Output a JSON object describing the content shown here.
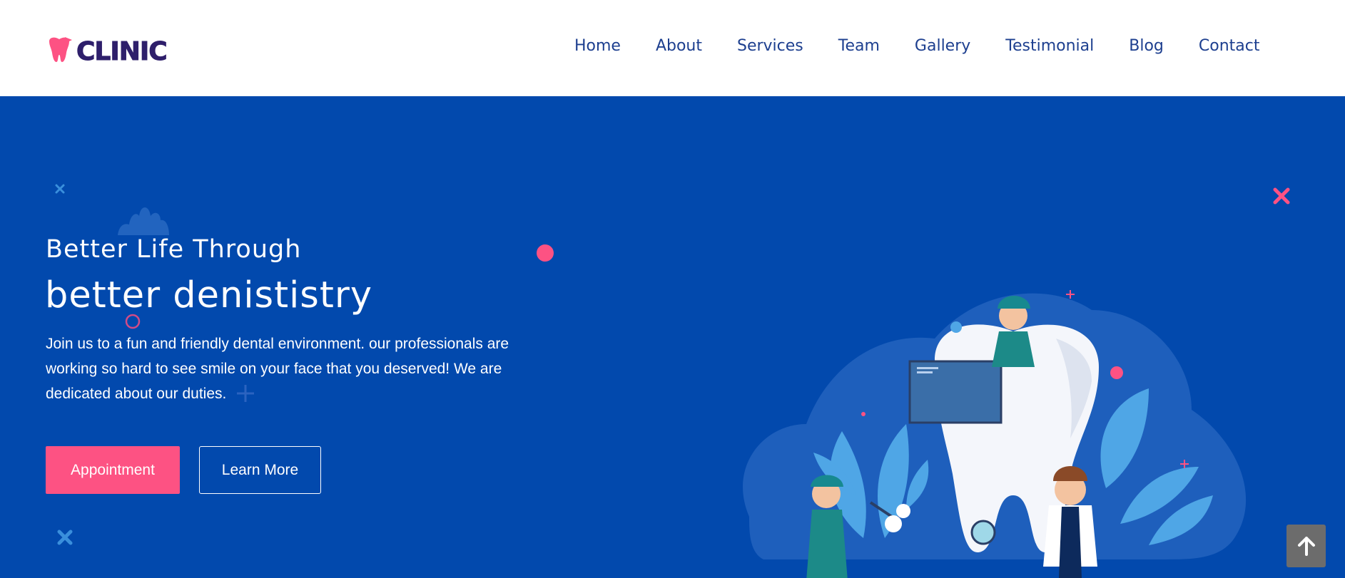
{
  "header": {
    "logo_text": "CLINIC",
    "nav": [
      "Home",
      "About",
      "Services",
      "Team",
      "Gallery",
      "Testimonial",
      "Blog",
      "Contact"
    ]
  },
  "hero": {
    "subtitle": "Better Life Through",
    "title": "better denististry",
    "description": "Join us to a fun and friendly dental environment. our professionals are working so hard to see smile on your face that you deserved! We are dedicated about our duties.",
    "primary_button": "Appointment",
    "secondary_button": "Learn More"
  },
  "icons": {
    "logo": "tooth-icon",
    "scroll_top": "arrow-up-icon"
  },
  "colors": {
    "hero_bg": "#0249ad",
    "accent": "#fd5283",
    "nav_text": "#1d3f8f",
    "logo_text": "#2e1f6b"
  }
}
